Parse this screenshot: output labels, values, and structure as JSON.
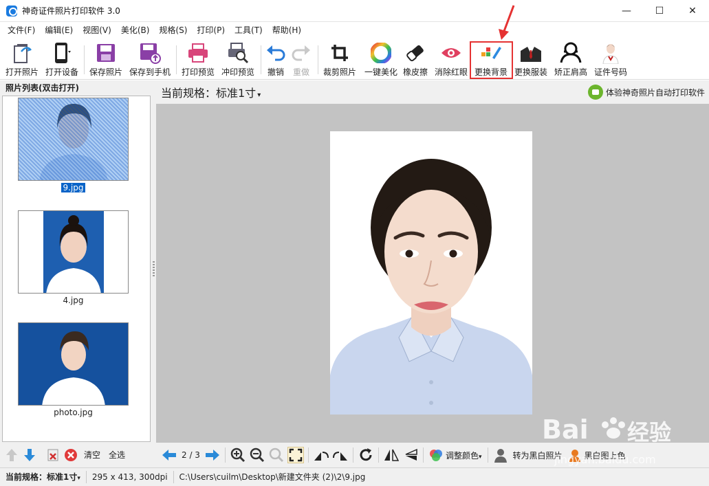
{
  "window": {
    "title": "神奇证件照片打印软件 3.0",
    "minimize": "—",
    "maximize": "☐",
    "close": "✕"
  },
  "menu": [
    "文件(F)",
    "编辑(E)",
    "视图(V)",
    "美化(B)",
    "规格(S)",
    "打印(P)",
    "工具(T)",
    "帮助(H)"
  ],
  "toolbar": {
    "open_photo": "打开照片",
    "open_device": "打开设备",
    "save_photo": "保存照片",
    "save_to_phone": "保存到手机",
    "print_preview": "打印预览",
    "develop_preview": "冲印预览",
    "undo": "撤销",
    "redo": "重做",
    "crop": "裁剪照片",
    "one_click_beautify": "一键美化",
    "eraser": "橡皮擦",
    "red_eye": "消除红眼",
    "change_background": "更换背景",
    "change_clothes": "更换服装",
    "fix_shoulders": "矫正肩高",
    "id_number": "证件号码"
  },
  "left_panel": {
    "header": "照片列表(双击打开)",
    "photos": [
      {
        "name": "9.jpg",
        "selected": true,
        "bg": "#ffffff"
      },
      {
        "name": "4.jpg",
        "selected": false,
        "bg": "#1e5fb0"
      },
      {
        "name": "photo.jpg",
        "selected": false,
        "bg": "#15519e"
      }
    ],
    "clear": "清空",
    "select_all": "全选"
  },
  "main": {
    "current_spec": "当前规格：标准1寸",
    "promo": "体验神奇照片自动打印软件"
  },
  "bottom_tools": {
    "page": "2 / 3",
    "adjust_color": "调整颜色",
    "to_bw": "转为黑白照片",
    "colorize": "黑白图上色"
  },
  "status": {
    "spec_label": "当前规格：",
    "spec_value": "标准1寸",
    "size": "295 x 413, 300dpi",
    "path": "C:\\Users\\cuilm\\Desktop\\新建文件夹 (2)\\2\\9.jpg"
  },
  "watermark": {
    "brand": "Bai",
    "brand2": "经验",
    "url": "jingyan.baidu.com"
  },
  "colors": {
    "accent": "#1a7be0",
    "highlight": "#e53232",
    "canvas": "#c3c3c3",
    "shirt": "#c9d6ee"
  }
}
